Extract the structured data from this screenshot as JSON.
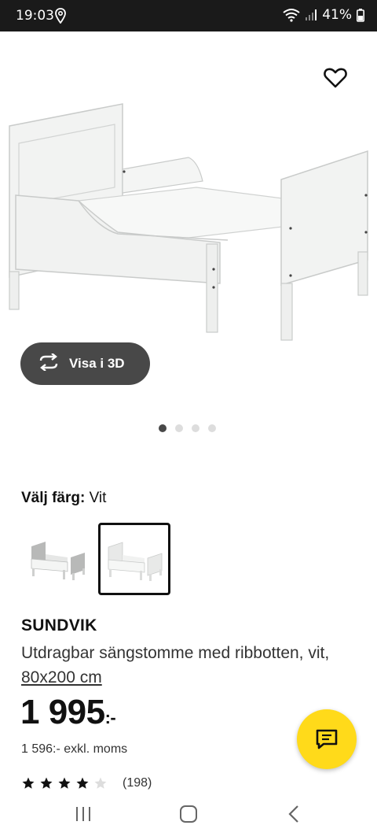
{
  "status_bar": {
    "time": "19:03",
    "battery": "41%"
  },
  "hero": {
    "view3d_label": "Visa i 3D",
    "pager": {
      "count": 4,
      "active": 0
    }
  },
  "color": {
    "label": "Välj färg:",
    "value": "Vit",
    "swatches": [
      "gray-white",
      "white"
    ],
    "selected": 1
  },
  "product": {
    "name": "SUNDVIK",
    "description": "Utdragbar sängstomme med ribbotten, vit,",
    "size_link": "80x200 cm",
    "price": "1 995",
    "price_suffix": ":-",
    "price_ex_vat": "1 596:- exkl. moms",
    "rating_stars": 4,
    "rating_count": "(198)"
  },
  "colors": {
    "chat_button": "#FFDA1A",
    "dark_pill": "#484848",
    "status_bar": "#1a1a1a"
  }
}
